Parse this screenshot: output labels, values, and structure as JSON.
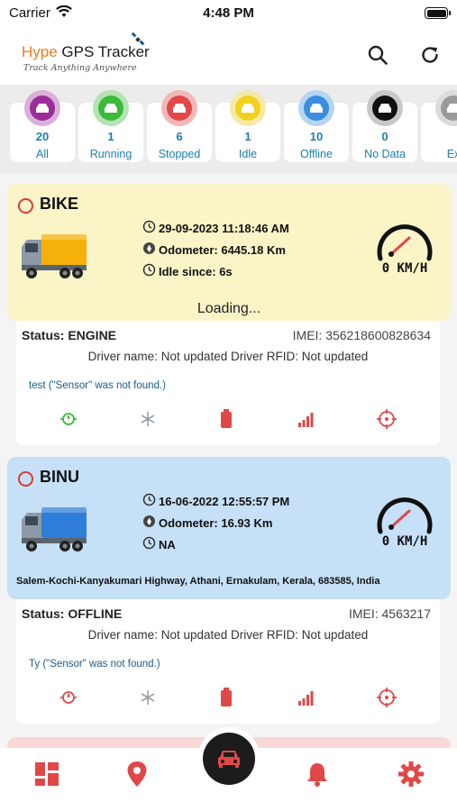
{
  "status_bar": {
    "carrier": "Carrier",
    "time": "4:48 PM"
  },
  "header": {
    "title_part1": "Hype",
    "title_part2": " GPS Tracker",
    "tagline": "Track Anything Anywhere",
    "search_icon": "search-icon",
    "refresh_icon": "refresh-icon"
  },
  "filters": [
    {
      "count": "20",
      "label": "All",
      "color": "#9b2d9b",
      "ring": "#d9b0d9"
    },
    {
      "count": "1",
      "label": "Running",
      "color": "#3cba3c",
      "ring": "#b6e3b6"
    },
    {
      "count": "6",
      "label": "Stopped",
      "color": "#e04848",
      "ring": "#f2b8b8"
    },
    {
      "count": "1",
      "label": "Idle",
      "color": "#f2d11e",
      "ring": "#f5e9a8"
    },
    {
      "count": "10",
      "label": "Offline",
      "color": "#3a8ee0",
      "ring": "#b5d5f2"
    },
    {
      "count": "0",
      "label": "No Data",
      "color": "#111111",
      "ring": "#c8c8c8"
    },
    {
      "count": "",
      "label": "Ex",
      "color": "#9a9a9a",
      "ring": "#dcdcdc"
    }
  ],
  "vehicles": [
    {
      "name": "BIKE",
      "datetime": "29-09-2023 11:18:46 AM",
      "odometer": "Odometer: 6445.18 Km",
      "since": "Idle since: 6s",
      "speed": "0 KM/H",
      "extra": "Loading...",
      "status": "Status: ENGINE",
      "imei": "IMEI: 356218600828634",
      "driver": "Driver name: Not updated Driver RFID: Not updated",
      "note": "test (\"Sensor\" was not found.)",
      "bg": "#fbf4c7",
      "truck_color": "#f5b10a",
      "ignition_color": "#3cba3c"
    },
    {
      "name": "BINU",
      "datetime": "16-06-2022 12:55:57 PM",
      "odometer": "Odometer: 16.93 Km",
      "since": "NA",
      "speed": "0 KM/H",
      "extra": "Salem-Kochi-Kanyakumari Highway, Athani, Ernakulam, Kerala, 683585, India",
      "status": "Status: OFFLINE",
      "imei": "IMEI: 4563217",
      "driver": "Driver name: Not updated Driver RFID: Not updated",
      "note": "Ty (\"Sensor\" was not found.)",
      "bg": "#c5e0f7",
      "truck_color": "#2f7fd8",
      "ignition_color": "#e04848"
    }
  ],
  "bottom_nav": [
    "dashboard-icon",
    "location-pin-icon",
    "vehicle-icon",
    "bell-icon",
    "gear-icon"
  ],
  "colors": {
    "accent_red": "#e04848",
    "link_blue": "#1a7fb0"
  }
}
